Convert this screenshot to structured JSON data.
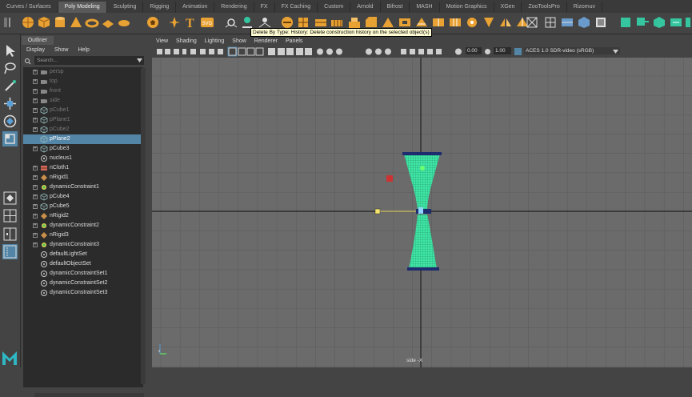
{
  "shelf_tabs": [
    "Curves / Surfaces",
    "Poly Modeling",
    "Sculpting",
    "Rigging",
    "Animation",
    "Rendering",
    "FX",
    "FX Caching",
    "Custom",
    "Arnold",
    "Bifrost",
    "MASH",
    "Motion Graphics",
    "XGen",
    "ZooToolsPro",
    "Rizomuv"
  ],
  "active_shelf_tab": "Poly Modeling",
  "tooltip": "Delete By Type: History: Delete construction history on the selected object(s)",
  "outliner": {
    "title": "Outliner",
    "menu": [
      "Display",
      "Show",
      "Help"
    ],
    "search_placeholder": "Search...",
    "items": [
      {
        "label": "persp",
        "icon": "camera-icon",
        "dim": true,
        "expander": true
      },
      {
        "label": "top",
        "icon": "camera-icon",
        "dim": true,
        "expander": true
      },
      {
        "label": "front",
        "icon": "camera-icon",
        "dim": true,
        "expander": true
      },
      {
        "label": "side",
        "icon": "camera-icon",
        "dim": true,
        "expander": true
      },
      {
        "label": "pCube1",
        "icon": "mesh-icon",
        "dim": true,
        "expander": true
      },
      {
        "label": "pPlane1",
        "icon": "mesh-icon",
        "dim": true,
        "expander": true
      },
      {
        "label": "pCube2",
        "icon": "mesh-icon",
        "dim": true,
        "expander": true
      },
      {
        "label": "pPlane2",
        "icon": "mesh-icon",
        "selected": true
      },
      {
        "label": "pCube3",
        "icon": "mesh-icon",
        "expander": true
      },
      {
        "label": "nucleus1",
        "icon": "nucleus-icon"
      },
      {
        "label": "nCloth1",
        "icon": "ncloth-icon",
        "expander": true
      },
      {
        "label": "nRigid1",
        "icon": "nrigid-icon",
        "expander": true
      },
      {
        "label": "dynamicConstraint1",
        "icon": "constraint-icon",
        "expander": true
      },
      {
        "label": "pCube4",
        "icon": "mesh-icon",
        "expander": true
      },
      {
        "label": "pCube5",
        "icon": "mesh-icon",
        "expander": true
      },
      {
        "label": "nRigid2",
        "icon": "nrigid-icon",
        "expander": true
      },
      {
        "label": "dynamicConstraint2",
        "icon": "constraint-icon",
        "expander": true
      },
      {
        "label": "nRigid3",
        "icon": "nrigid-icon",
        "expander": true
      },
      {
        "label": "dynamicConstraint3",
        "icon": "constraint-icon",
        "expander": true
      },
      {
        "label": "defaultLightSet",
        "icon": "set-icon"
      },
      {
        "label": "defaultObjectSet",
        "icon": "set-icon"
      },
      {
        "label": "dynamicConstraintSet1",
        "icon": "set-icon"
      },
      {
        "label": "dynamicConstraintSet2",
        "icon": "set-icon"
      },
      {
        "label": "dynamicConstraintSet3",
        "icon": "set-icon"
      }
    ]
  },
  "view_menu": [
    "View",
    "Shading",
    "Lighting",
    "Show",
    "Renderer",
    "Panels"
  ],
  "view_toolbar": {
    "exposure": "0.00",
    "gamma": "1.00",
    "color_space": "ACES 1.0 SDR-video (sRGB)"
  },
  "viewport": {
    "camera_label": "side -X",
    "background": "#6b6b6b",
    "cloth_color": "#3fe6a4"
  },
  "colors": {
    "selection": "#5285a6",
    "panel": "#444444",
    "dark": "#2b2b2b",
    "orange": "#e8a133",
    "teal": "#35c6a0"
  }
}
